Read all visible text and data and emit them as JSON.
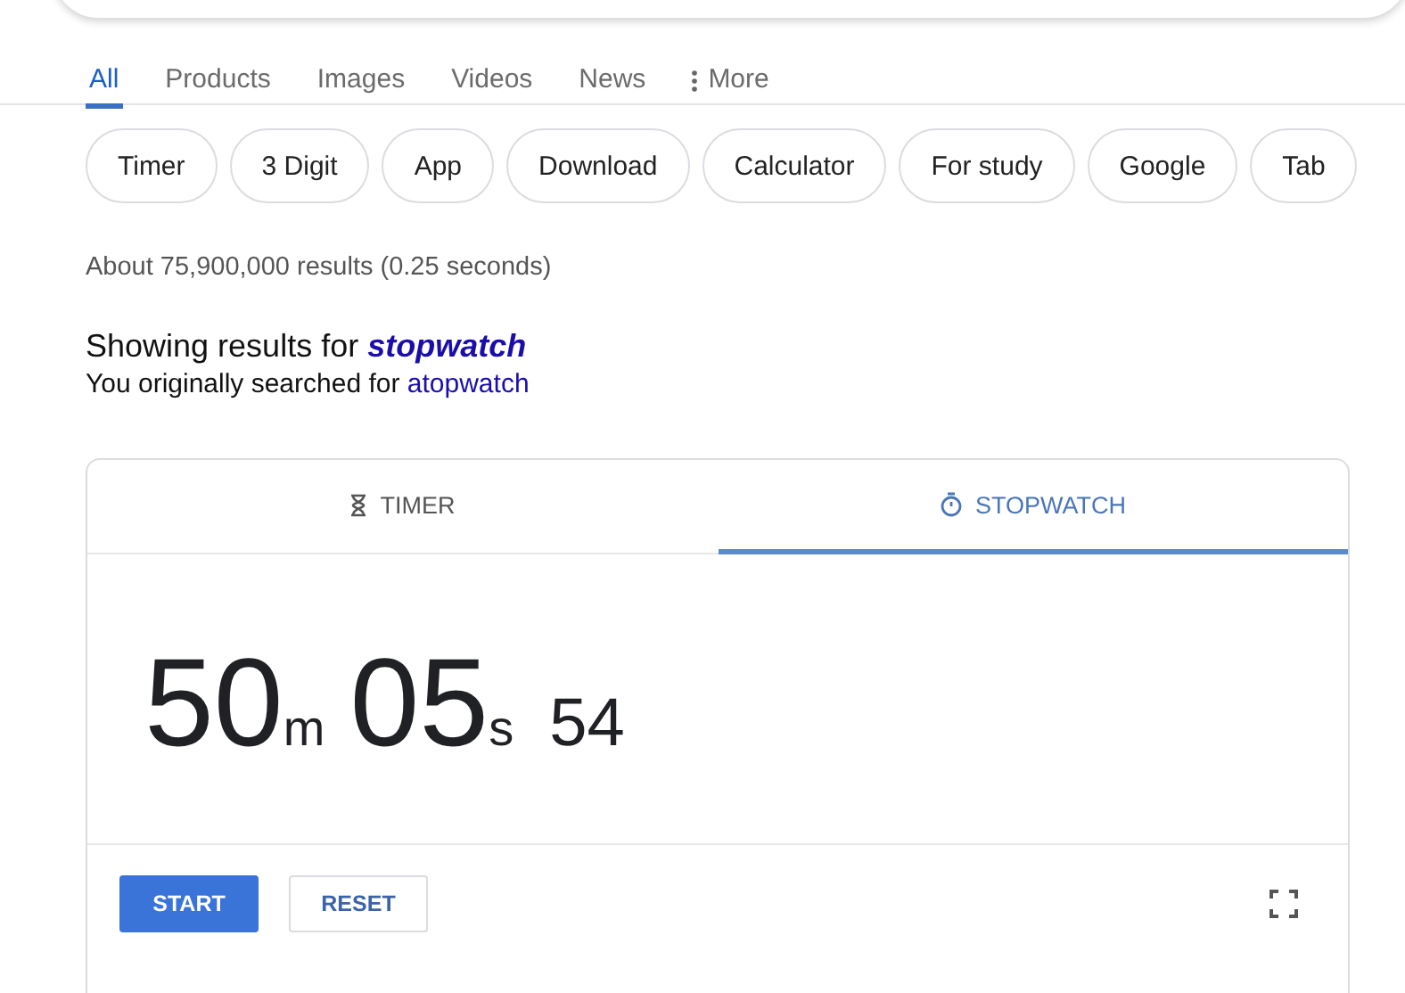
{
  "nav_tabs": [
    {
      "label": "All",
      "selected": true,
      "kind": "text"
    },
    {
      "label": "Products",
      "selected": false,
      "kind": "text"
    },
    {
      "label": "Images",
      "selected": false,
      "kind": "text"
    },
    {
      "label": "Videos",
      "selected": false,
      "kind": "text"
    },
    {
      "label": "News",
      "selected": false,
      "kind": "text"
    },
    {
      "label": "More",
      "selected": false,
      "kind": "more"
    }
  ],
  "chips": [
    "Timer",
    "3 Digit",
    "App",
    "Download",
    "Calculator",
    "For study",
    "Google",
    "Tab"
  ],
  "result_stats": "About 75,900,000 results (0.25 seconds)",
  "correction": {
    "showing": "Showing results for",
    "corrected": "stopwatch",
    "original_prefix": "You originally searched for",
    "original": "atopwatch"
  },
  "widget": {
    "tabs": [
      {
        "label": "TIMER",
        "kind": "timer",
        "selected": false
      },
      {
        "label": "STOPWATCH",
        "kind": "stopwatch",
        "selected": true
      }
    ],
    "time": {
      "minutes": "50",
      "minutes_unit": "m",
      "seconds": "05",
      "seconds_unit": "s",
      "hundredths": "54"
    },
    "buttons": [
      {
        "label": "START",
        "kind": "primary"
      },
      {
        "label": "RESET",
        "kind": "secondary"
      }
    ]
  }
}
